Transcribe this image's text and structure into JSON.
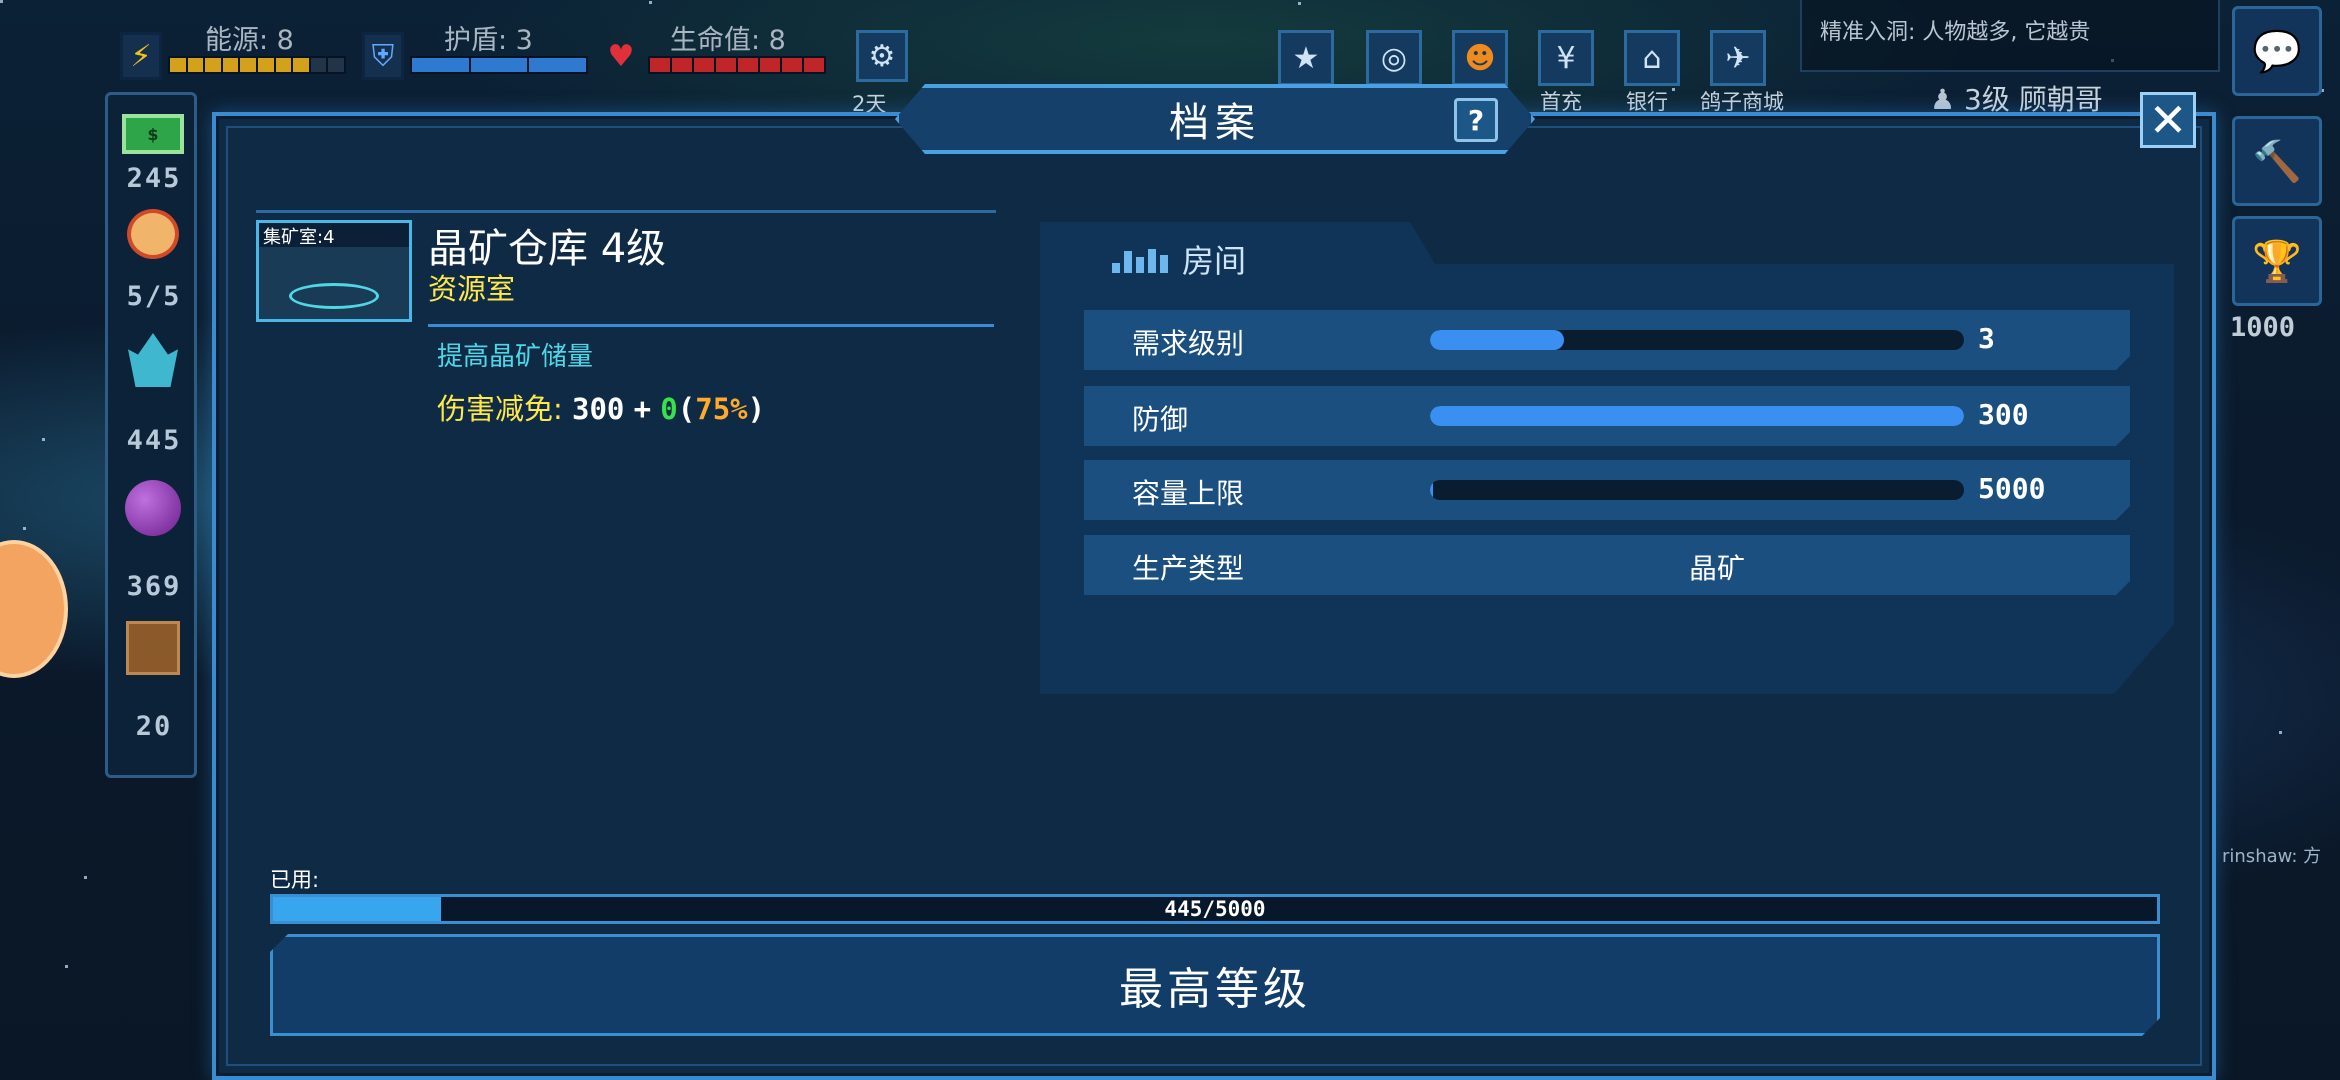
{
  "hud": {
    "energy": {
      "label": "能源: 8",
      "filled": 8,
      "total": 10,
      "color": "#d4a21a"
    },
    "shield": {
      "label": "护盾: 3",
      "filled": 3,
      "total": 3,
      "color": "#2f79d0"
    },
    "hp": {
      "label": "生命值: 8",
      "filled": 8,
      "total": 8,
      "color": "#c0252a"
    },
    "timer_label": "2天"
  },
  "top_buttons": [
    {
      "icon": "star-badge-icon",
      "label": ""
    },
    {
      "icon": "planet-icon",
      "label": ""
    },
    {
      "icon": "pumpkin-icon",
      "label": ""
    },
    {
      "icon": "yen-icon",
      "label": "首充"
    },
    {
      "icon": "bank-icon",
      "label": "银行"
    },
    {
      "icon": "pigeon-icon",
      "label": "鸽子商城"
    }
  ],
  "news_ticker": "精准入洞: 人物越多, 它越贵",
  "player": {
    "rank": "3级",
    "name": "顾朝哥"
  },
  "resources": [
    {
      "icon": "money-icon",
      "value": "245"
    },
    {
      "icon": "crew-icon",
      "value": "5/5"
    },
    {
      "icon": "crystal-icon",
      "value": "445"
    },
    {
      "icon": "fuel-orb-icon",
      "value": "369"
    },
    {
      "icon": "crate-icon",
      "value": "20"
    }
  ],
  "side": {
    "trophy_value": "1000",
    "ship_label": "rinshaw: 方"
  },
  "panel": {
    "title": "档案",
    "help": "?",
    "close": "✕"
  },
  "building": {
    "thumb_label": "集矿室:4",
    "name": "晶矿仓库 4级",
    "type": "资源室",
    "desc": "提高晶矿储量",
    "stat_label": "伤害减免:",
    "stat_base": "300",
    "stat_plus": "+",
    "stat_bonus": "0",
    "stat_pct_open": "(",
    "stat_pct": "75%",
    "stat_pct_close": ")"
  },
  "room": {
    "heading": "房间",
    "rows": [
      {
        "label": "需求级别",
        "value": "3",
        "fill": 0.25
      },
      {
        "label": "防御",
        "value": "300",
        "fill": 1.0
      },
      {
        "label": "容量上限",
        "value": "5000",
        "fill": 0.0
      },
      {
        "label": "生产类型",
        "value": "晶矿"
      }
    ]
  },
  "usage": {
    "label": "已用:",
    "text": "445/5000",
    "fill": 0.089
  },
  "max_button": "最高等级",
  "colors": {
    "accent": "#3a8bd0",
    "yellow": "#ffe84a",
    "cyan": "#4fd7e8",
    "green": "#38e04a",
    "orange": "#ffaa2a"
  }
}
